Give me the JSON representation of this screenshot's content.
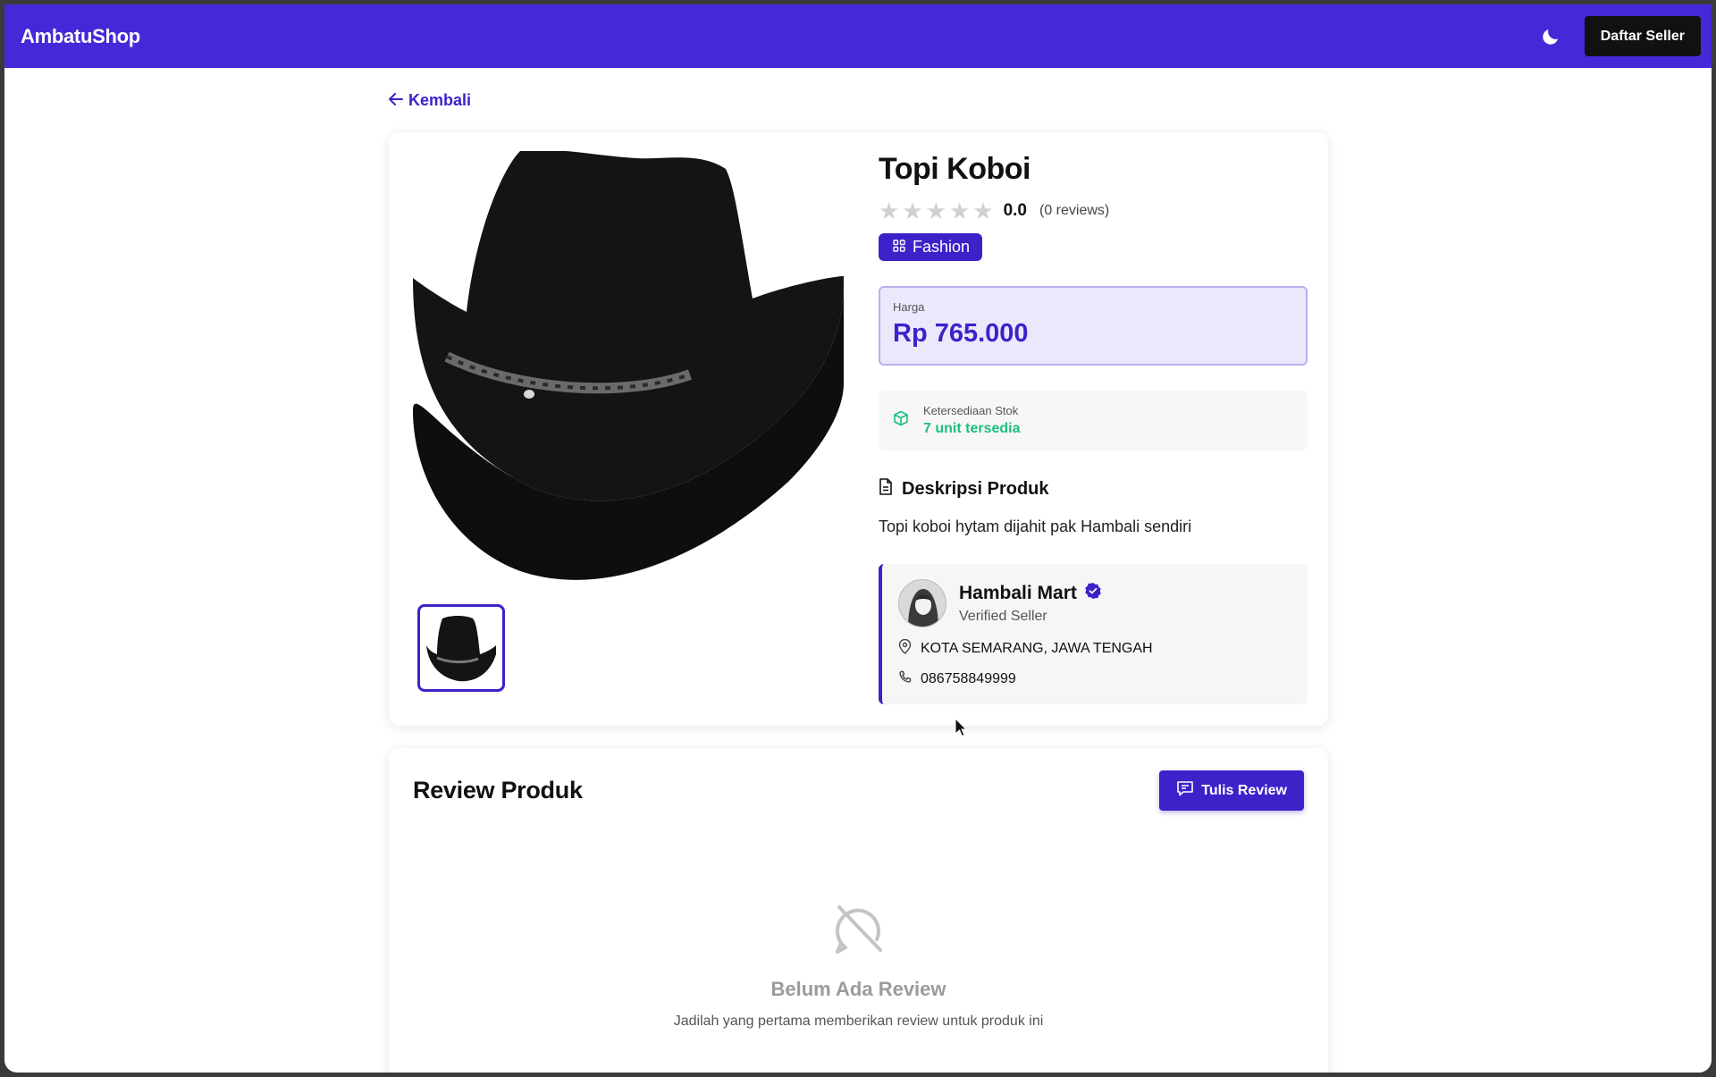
{
  "navbar": {
    "brand": "AmbatuShop",
    "theme_toggle_icon": "moon-icon",
    "seller_button": "Daftar Seller"
  },
  "back_link": "Kembali",
  "product": {
    "title": "Topi Koboi",
    "rating": "0.0",
    "rating_stars_filled": 0,
    "rating_stars_total": 5,
    "review_count": "(0 reviews)",
    "category": "Fashion",
    "price_label": "Harga",
    "price": "Rp 765.000",
    "stock_label": "Ketersediaan Stok",
    "stock_value": "7 unit tersedia",
    "description_title": "Deskripsi Produk",
    "description": "Topi koboi hytam dijahit pak Hambali sendiri"
  },
  "seller": {
    "name": "Hambali Mart",
    "status": "Verified Seller",
    "location": "KOTA SEMARANG, JAWA TENGAH",
    "phone": "086758849999"
  },
  "reviews": {
    "title": "Review Produk",
    "write_button": "Tulis Review",
    "empty_title": "Belum Ada Review",
    "empty_subtitle": "Jadilah yang pertama memberikan review untuk produk ini"
  },
  "colors": {
    "primary": "#4429d9",
    "accent": "#3d22c9",
    "stock_green": "#1cbf7e",
    "price_bg": "#ebe8fb"
  }
}
